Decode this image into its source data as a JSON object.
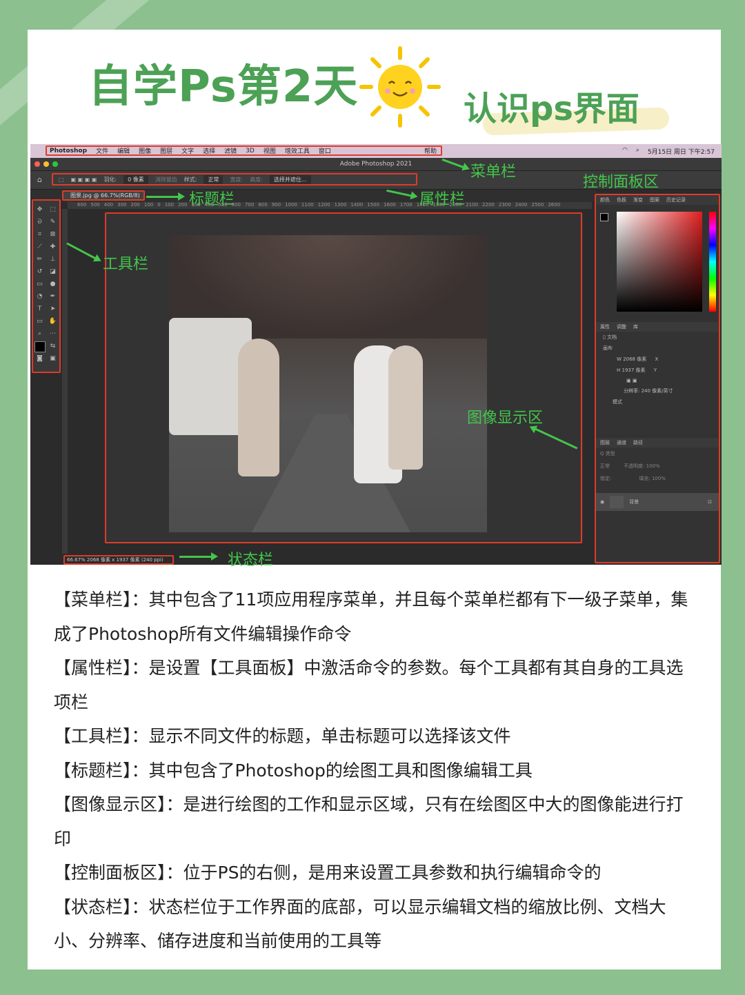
{
  "header": {
    "title": "自学Ps第2天",
    "subtitle": "认识ps界面"
  },
  "mac_menubar": {
    "items": [
      "Photoshop",
      "文件",
      "编辑",
      "图像",
      "图层",
      "文字",
      "选择",
      "滤镜",
      "3D",
      "视图",
      "增效工具",
      "窗口"
    ],
    "help": "帮助",
    "clock": "5月15日 周日 下午2:57"
  },
  "ps": {
    "window_title": "Adobe Photoshop 2021",
    "options": {
      "feather_label": "羽化:",
      "feather_value": "0 像素",
      "antialias": "消除锯齿",
      "style_label": "样式:",
      "style_value": "正常",
      "width_label": "宽度:",
      "height_label": "高度:",
      "select_mask": "选择并遮住..."
    },
    "doc_tab": "图景.jpg @ 66.7%(RGB/8)",
    "ruler": [
      "600",
      "500",
      "400",
      "300",
      "200",
      "100",
      "0",
      "100",
      "200",
      "300",
      "400",
      "500",
      "600",
      "700",
      "800",
      "900",
      "1000",
      "1100",
      "1200",
      "1300",
      "1400",
      "1500",
      "1600",
      "1700",
      "1800",
      "1900",
      "2000",
      "2100",
      "2200",
      "2300",
      "2400",
      "2500",
      "2600"
    ],
    "status": "66.67%   2068 像素 x 1937 像素 (240 ppi)",
    "panels": {
      "color_tabs": [
        "颜色",
        "色板",
        "渐变",
        "图案",
        "历史记录"
      ],
      "prop_tabs": [
        "属性",
        "调整",
        "库"
      ],
      "doc_label": "文档",
      "canvas_label": "画布",
      "w_label": "W",
      "w_value": "2068 像素",
      "x_label": "X",
      "h_label": "H",
      "h_value": "1937 像素",
      "y_label": "Y",
      "resolution": "分辨率: 240 像素/英寸",
      "mode_label": "模式",
      "layer_tabs": [
        "图层",
        "通道",
        "路径"
      ],
      "layer_kind": "Q 类型",
      "blend_mode": "正常",
      "opacity": "不透明度: 100%",
      "lock_label": "锁定:",
      "fill": "填充: 100%",
      "layer_name": "背景"
    }
  },
  "callouts": {
    "menubar": "菜单栏",
    "panel_area": "控制面板区",
    "title_bar": "标题栏",
    "options_bar": "属性栏",
    "toolbar": "工具栏",
    "image_area": "图像显示区",
    "status_bar": "状态栏"
  },
  "descriptions": [
    "【菜单栏】：其中包含了11项应用程序菜单，并且每个菜单栏都有下一级子菜单，集成了Photoshop所有文件编辑操作命令",
    "【属性栏】：是设置【工具面板】中激活命令的参数。每个工具都有其自身的工具选项栏",
    "【工具栏】：显示不同文件的标题，单击标题可以选择该文件",
    "【标题栏】：其中包含了Photoshop的绘图工具和图像编辑工具",
    "【图像显示区】：是进行绘图的工作和显示区域，只有在绘图区中大的图像能进行打印",
    "【控制面板区】：位于PS的右侧，是用来设置工具参数和执行编辑命令的",
    "【状态栏】：状态栏位于工作界面的底部，可以显示编辑文档的缩放比例、文档大小、分辨率、储存进度和当前使用的工具等"
  ],
  "colors": {
    "background": "#8cc08f",
    "title_green": "#4ca155",
    "callout_green": "#43c64b",
    "highlight_red": "#e03b2a"
  }
}
